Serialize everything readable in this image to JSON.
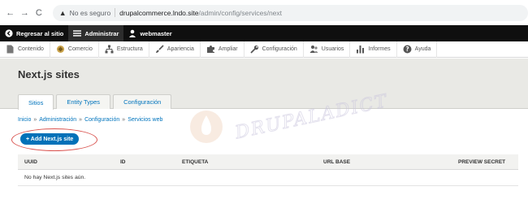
{
  "browser": {
    "back": "←",
    "forward": "→",
    "reload": "C",
    "security_icon": "▲",
    "security_text": "No es seguro",
    "host": "drupalcommerce.lndo.site",
    "path": "/admin/config/services/next"
  },
  "toolbar": {
    "back_label": "Regresar al sitio",
    "manage_label": "Administrar",
    "user_label": "webmaster"
  },
  "tray": {
    "items": [
      {
        "label": "Contenido",
        "icon": "file-icon"
      },
      {
        "label": "Comercio",
        "icon": "commerce-icon"
      },
      {
        "label": "Estructura",
        "icon": "structure-icon"
      },
      {
        "label": "Apariencia",
        "icon": "brush-icon"
      },
      {
        "label": "Ampliar",
        "icon": "puzzle-icon"
      },
      {
        "label": "Configuración",
        "icon": "wrench-icon"
      },
      {
        "label": "Usuarios",
        "icon": "users-icon"
      },
      {
        "label": "Informes",
        "icon": "chart-icon"
      },
      {
        "label": "Ayuda",
        "icon": "help-icon"
      }
    ]
  },
  "page": {
    "title": "Next.js sites",
    "tabs": [
      {
        "label": "Sitios",
        "active": true
      },
      {
        "label": "Entity Types",
        "active": false
      },
      {
        "label": "Configuración",
        "active": false
      }
    ]
  },
  "breadcrumb": [
    "Inicio",
    "Administración",
    "Configuración",
    "Servicios web"
  ],
  "breadcrumb_sep": "»",
  "add_button": "+ Add Next.js site",
  "table": {
    "headers": [
      "UUID",
      "ID",
      "ETIQUETA",
      "URL BASE",
      "PREVIEW SECRET"
    ],
    "empty": "No hay Next.js sites aún."
  },
  "watermark": "DRUPALADICTO",
  "colors": {
    "link": "#0074bd",
    "button": "#0071b8",
    "toolbar": "#0f0f0f",
    "highlight_ring": "#d9534f"
  }
}
